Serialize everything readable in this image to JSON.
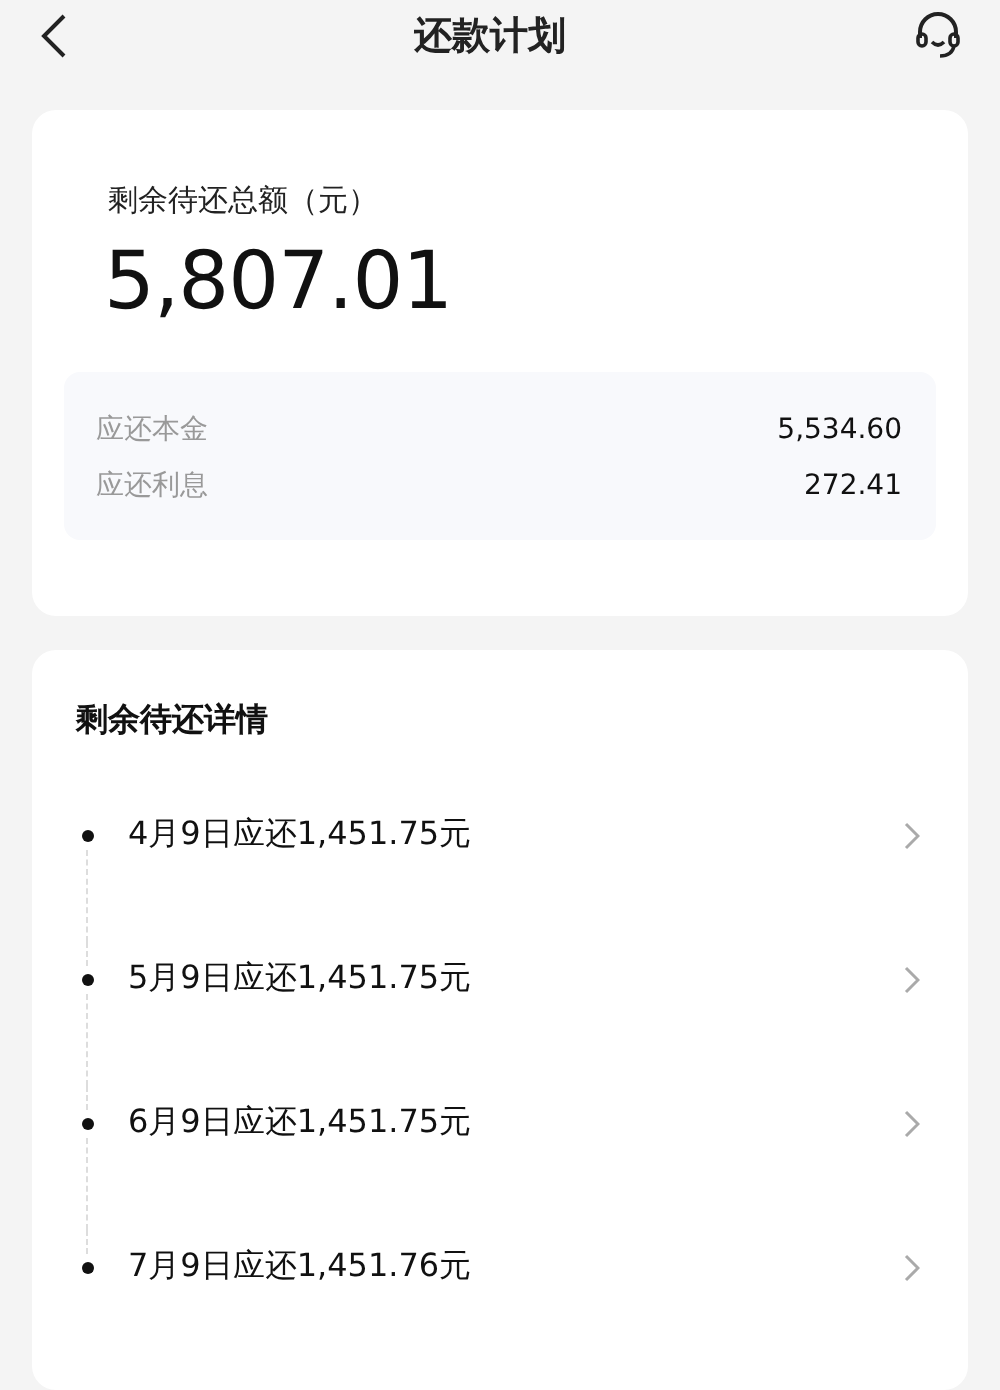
{
  "header": {
    "title": "还款计划"
  },
  "summary": {
    "label": "剩余待还总额（元）",
    "total": "5,807.01",
    "breakdown": [
      {
        "label": "应还本金",
        "value": "5,534.60"
      },
      {
        "label": "应还利息",
        "value": "272.41"
      }
    ]
  },
  "details": {
    "title": "剩余待还详情",
    "items": [
      {
        "text": "4月9日应还1,451.75元"
      },
      {
        "text": "5月9日应还1,451.75元"
      },
      {
        "text": "6月9日应还1,451.75元"
      },
      {
        "text": "7月9日应还1,451.76元"
      }
    ]
  }
}
